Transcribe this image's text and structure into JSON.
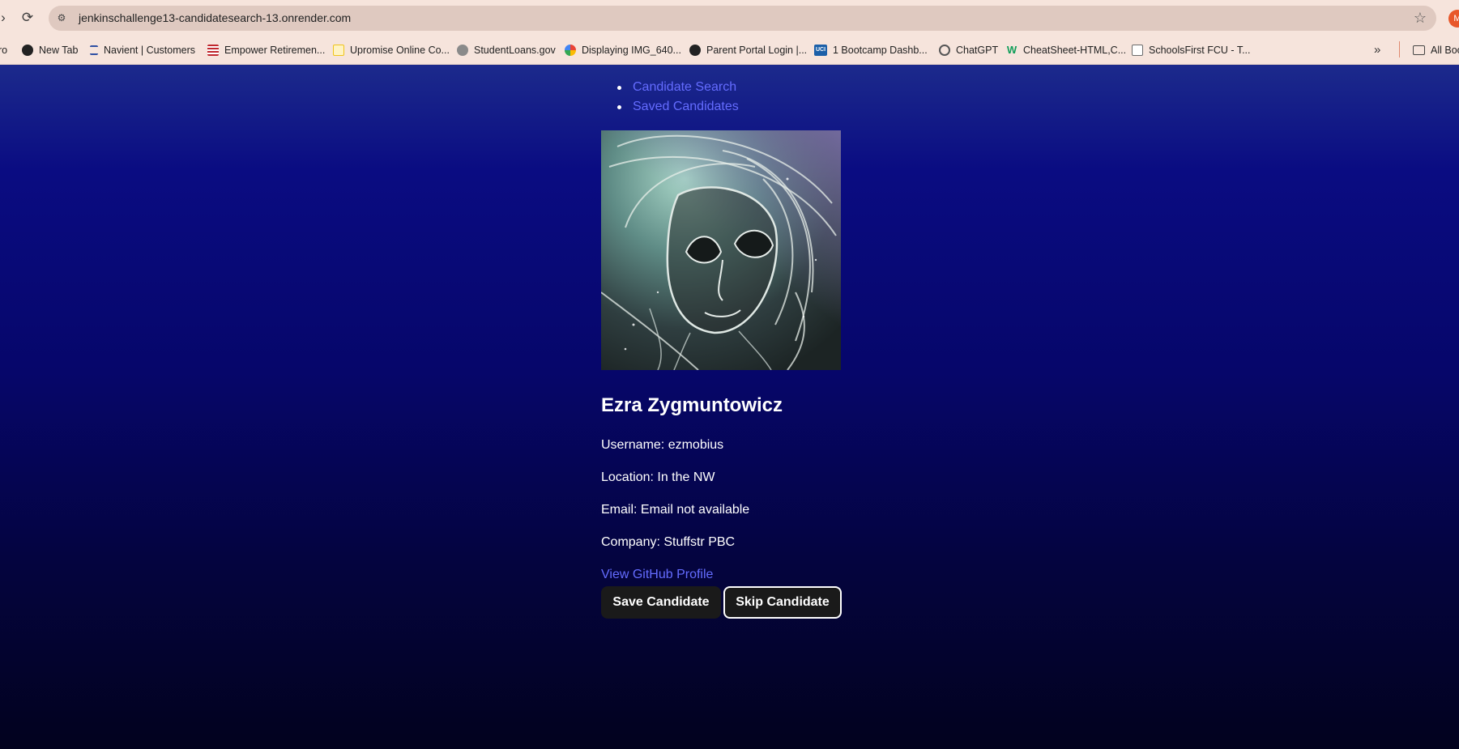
{
  "browser": {
    "url": "jenkinschallenge13-candidatesearch-13.onrender.com",
    "profile_initial": "M",
    "partial_left_label": "ro",
    "bookmarks": [
      {
        "label": "New Tab",
        "icon": "globe-icon",
        "color": "#222222"
      },
      {
        "label": "Navient | Customers",
        "icon": "navient-icon",
        "color": "#2d4fa3"
      },
      {
        "label": "Empower Retiremen...",
        "icon": "flag-icon",
        "color": "#c0272d"
      },
      {
        "label": "Upromise Online Co...",
        "icon": "upromise-icon",
        "color": "#f0c419"
      },
      {
        "label": "StudentLoans.gov",
        "icon": "seal-icon",
        "color": "#7a7a7a"
      },
      {
        "label": "Displaying IMG_640...",
        "icon": "photos-icon",
        "color": "#ea4335"
      },
      {
        "label": "Parent Portal Login |...",
        "icon": "globe-icon",
        "color": "#222222"
      },
      {
        "label": "1 Bootcamp Dashb...",
        "icon": "uci-icon",
        "color": "#1b5fa8",
        "icon_text": "UCI"
      },
      {
        "label": "ChatGPT",
        "icon": "chatgpt-icon",
        "color": "#555555"
      },
      {
        "label": "CheatSheet-HTML,C...",
        "icon": "w-icon",
        "color": "#0f9d58",
        "icon_text": "W"
      },
      {
        "label": "SchoolsFirst FCU - T...",
        "icon": "book-icon",
        "color": "#6b6b6b"
      }
    ],
    "all_bookmarks_label": "All Boo"
  },
  "nav": {
    "items": [
      {
        "label": "Candidate Search"
      },
      {
        "label": "Saved Candidates"
      }
    ]
  },
  "candidate": {
    "name": "Ezra Zygmuntowicz",
    "username": "Username: ezmobius",
    "location": "Location: In the NW",
    "email": "Email: Email not available",
    "company": "Company: Stuffstr PBC",
    "profile_link": "View GitHub Profile",
    "avatar_alt": "avatar"
  },
  "actions": {
    "save_label": "Save Candidate",
    "skip_label": "Skip Candidate"
  },
  "colors": {
    "link": "#646cff",
    "button_bg": "#1a1a1a"
  }
}
